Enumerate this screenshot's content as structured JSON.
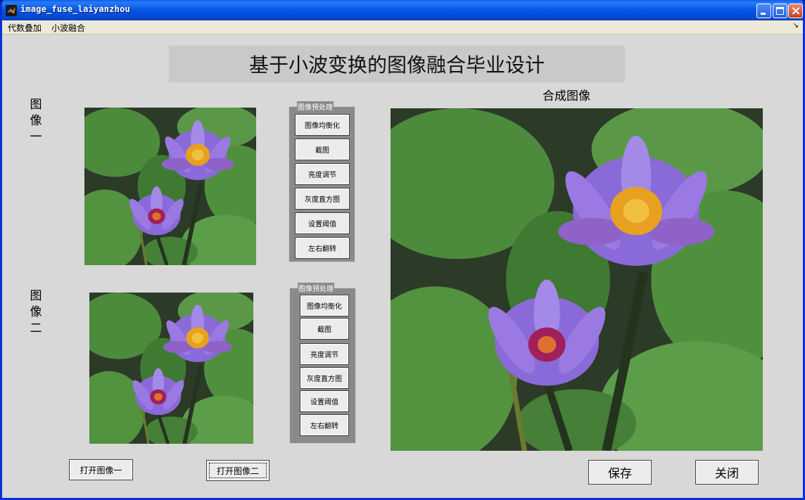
{
  "window": {
    "title": "image_fuse_laiyanzhou"
  },
  "menu": {
    "items": [
      "代数叠加",
      "小波融合"
    ]
  },
  "main": {
    "banner_title": "基于小波变换的图像融合毕业设计",
    "label_image1": "图像一",
    "label_image2": "图像二",
    "label_output": "合成图像"
  },
  "panel1": {
    "title": "图像预处理",
    "buttons": [
      "图像均衡化",
      "截图",
      "亮度调节",
      "灰度直方图",
      "设置阈值",
      "左右翻转"
    ]
  },
  "panel2": {
    "title": "图像预处理",
    "buttons": [
      "图像均衡化",
      "截图",
      "亮度调节",
      "灰度直方图",
      "设置阈值",
      "左右翻转"
    ]
  },
  "buttons": {
    "open1": "打开图像一",
    "open2": "打开图像二",
    "save": "保存",
    "close": "关闭"
  },
  "colors": {
    "titlebar": "#0555e6",
    "background": "#d8d8d8",
    "panel": "#8a8a8a"
  }
}
